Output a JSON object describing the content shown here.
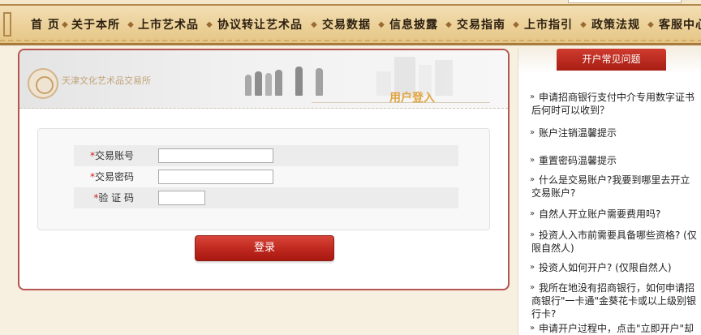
{
  "nav": {
    "items": [
      "首 页",
      "关于本所",
      "上市艺术品",
      "协议转让艺术品",
      "交易数据",
      "信息披露",
      "交易指南",
      "上市指引",
      "政策法规",
      "客服中心"
    ]
  },
  "banner": {
    "logo_text": "天津文化艺术品交易所",
    "title": "用户登入"
  },
  "form": {
    "account_label": "交易账号",
    "password_label": "交易密码",
    "captcha_label": "验 证 码",
    "required_mark": "*",
    "account_value": "",
    "password_value": "",
    "captcha_value": ""
  },
  "login_button": "登录",
  "sidebar": {
    "tab_label": "开户常见问题",
    "faq": [
      "申请招商银行支付中介专用数字证书后何时可以收到？",
      "账户注销温馨提示",
      "重置密码温馨提示",
      "什么是交易账户?我要到哪里去开立交易账户?",
      "自然人开立账户需要费用吗?",
      "投资人入市前需要具备哪些资格? (仅限自然人)",
      "投资人如何开户? (仅限自然人)",
      "我所在地没有招商银行，如何申请招商银行\"一卡通\"金葵花卡或以上级别银行卡?",
      "申请开户过程中，点击\"立即开户\"却提示验证码错误，如何解决?"
    ]
  },
  "colors": {
    "accent_red": "#b8231a",
    "nav_gold": "#ecd29b",
    "title_orange": "#e1a540",
    "required_red": "#d02020"
  },
  "icons": [
    "double-chevron-icon",
    "logo-emblem-icon"
  ]
}
